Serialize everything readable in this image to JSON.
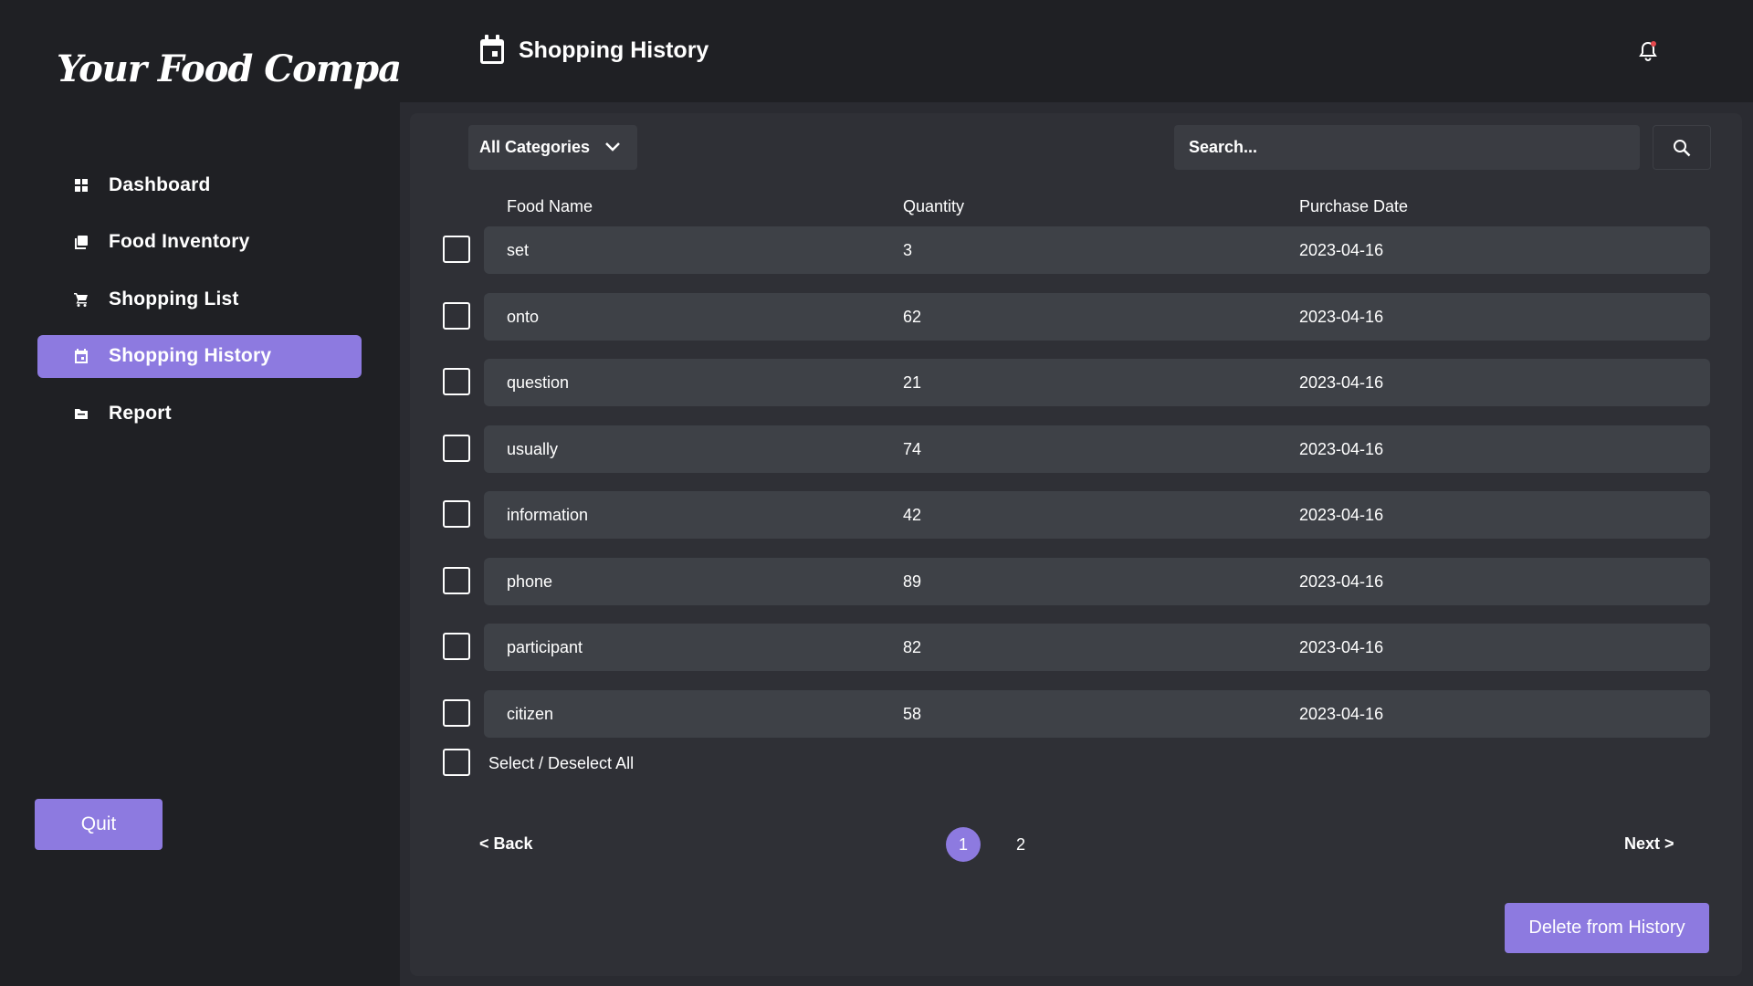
{
  "app": {
    "logo_text": "Your Food Companion"
  },
  "sidebar": {
    "items": [
      {
        "label": "Dashboard",
        "icon": "dashboard-icon",
        "active": false
      },
      {
        "label": "Food Inventory",
        "icon": "inventory-icon",
        "active": false
      },
      {
        "label": "Shopping List",
        "icon": "cart-icon",
        "active": false
      },
      {
        "label": "Shopping History",
        "icon": "calendar-icon",
        "active": true
      },
      {
        "label": "Report",
        "icon": "folder-icon",
        "active": false
      }
    ],
    "quit_label": "Quit"
  },
  "header": {
    "title": "Shopping History",
    "title_icon": "calendar-icon",
    "notification_icon": "bell-icon"
  },
  "filters": {
    "category_selected": "All Categories",
    "search_placeholder": "Search...",
    "search_icon": "search-icon"
  },
  "table": {
    "columns": [
      "Food Name",
      "Quantity",
      "Purchase Date"
    ],
    "rows": [
      {
        "name": "set",
        "quantity": "3",
        "date": "2023-04-16",
        "checked": false
      },
      {
        "name": "onto",
        "quantity": "62",
        "date": "2023-04-16",
        "checked": false
      },
      {
        "name": "question",
        "quantity": "21",
        "date": "2023-04-16",
        "checked": false
      },
      {
        "name": "usually",
        "quantity": "74",
        "date": "2023-04-16",
        "checked": false
      },
      {
        "name": "information",
        "quantity": "42",
        "date": "2023-04-16",
        "checked": false
      },
      {
        "name": "phone",
        "quantity": "89",
        "date": "2023-04-16",
        "checked": false
      },
      {
        "name": "participant",
        "quantity": "82",
        "date": "2023-04-16",
        "checked": false
      },
      {
        "name": "citizen",
        "quantity": "58",
        "date": "2023-04-16",
        "checked": false
      }
    ],
    "select_all_label": "Select / Deselect All"
  },
  "pagination": {
    "back_label": "< Back",
    "next_label": "Next >",
    "pages": [
      "1",
      "2"
    ],
    "current_page": "1"
  },
  "actions": {
    "delete_label": "Delete from History"
  },
  "colors": {
    "accent": "#8d7ae0",
    "background": "#1f2024",
    "panel": "#2f3036",
    "row": "#3e4147"
  }
}
